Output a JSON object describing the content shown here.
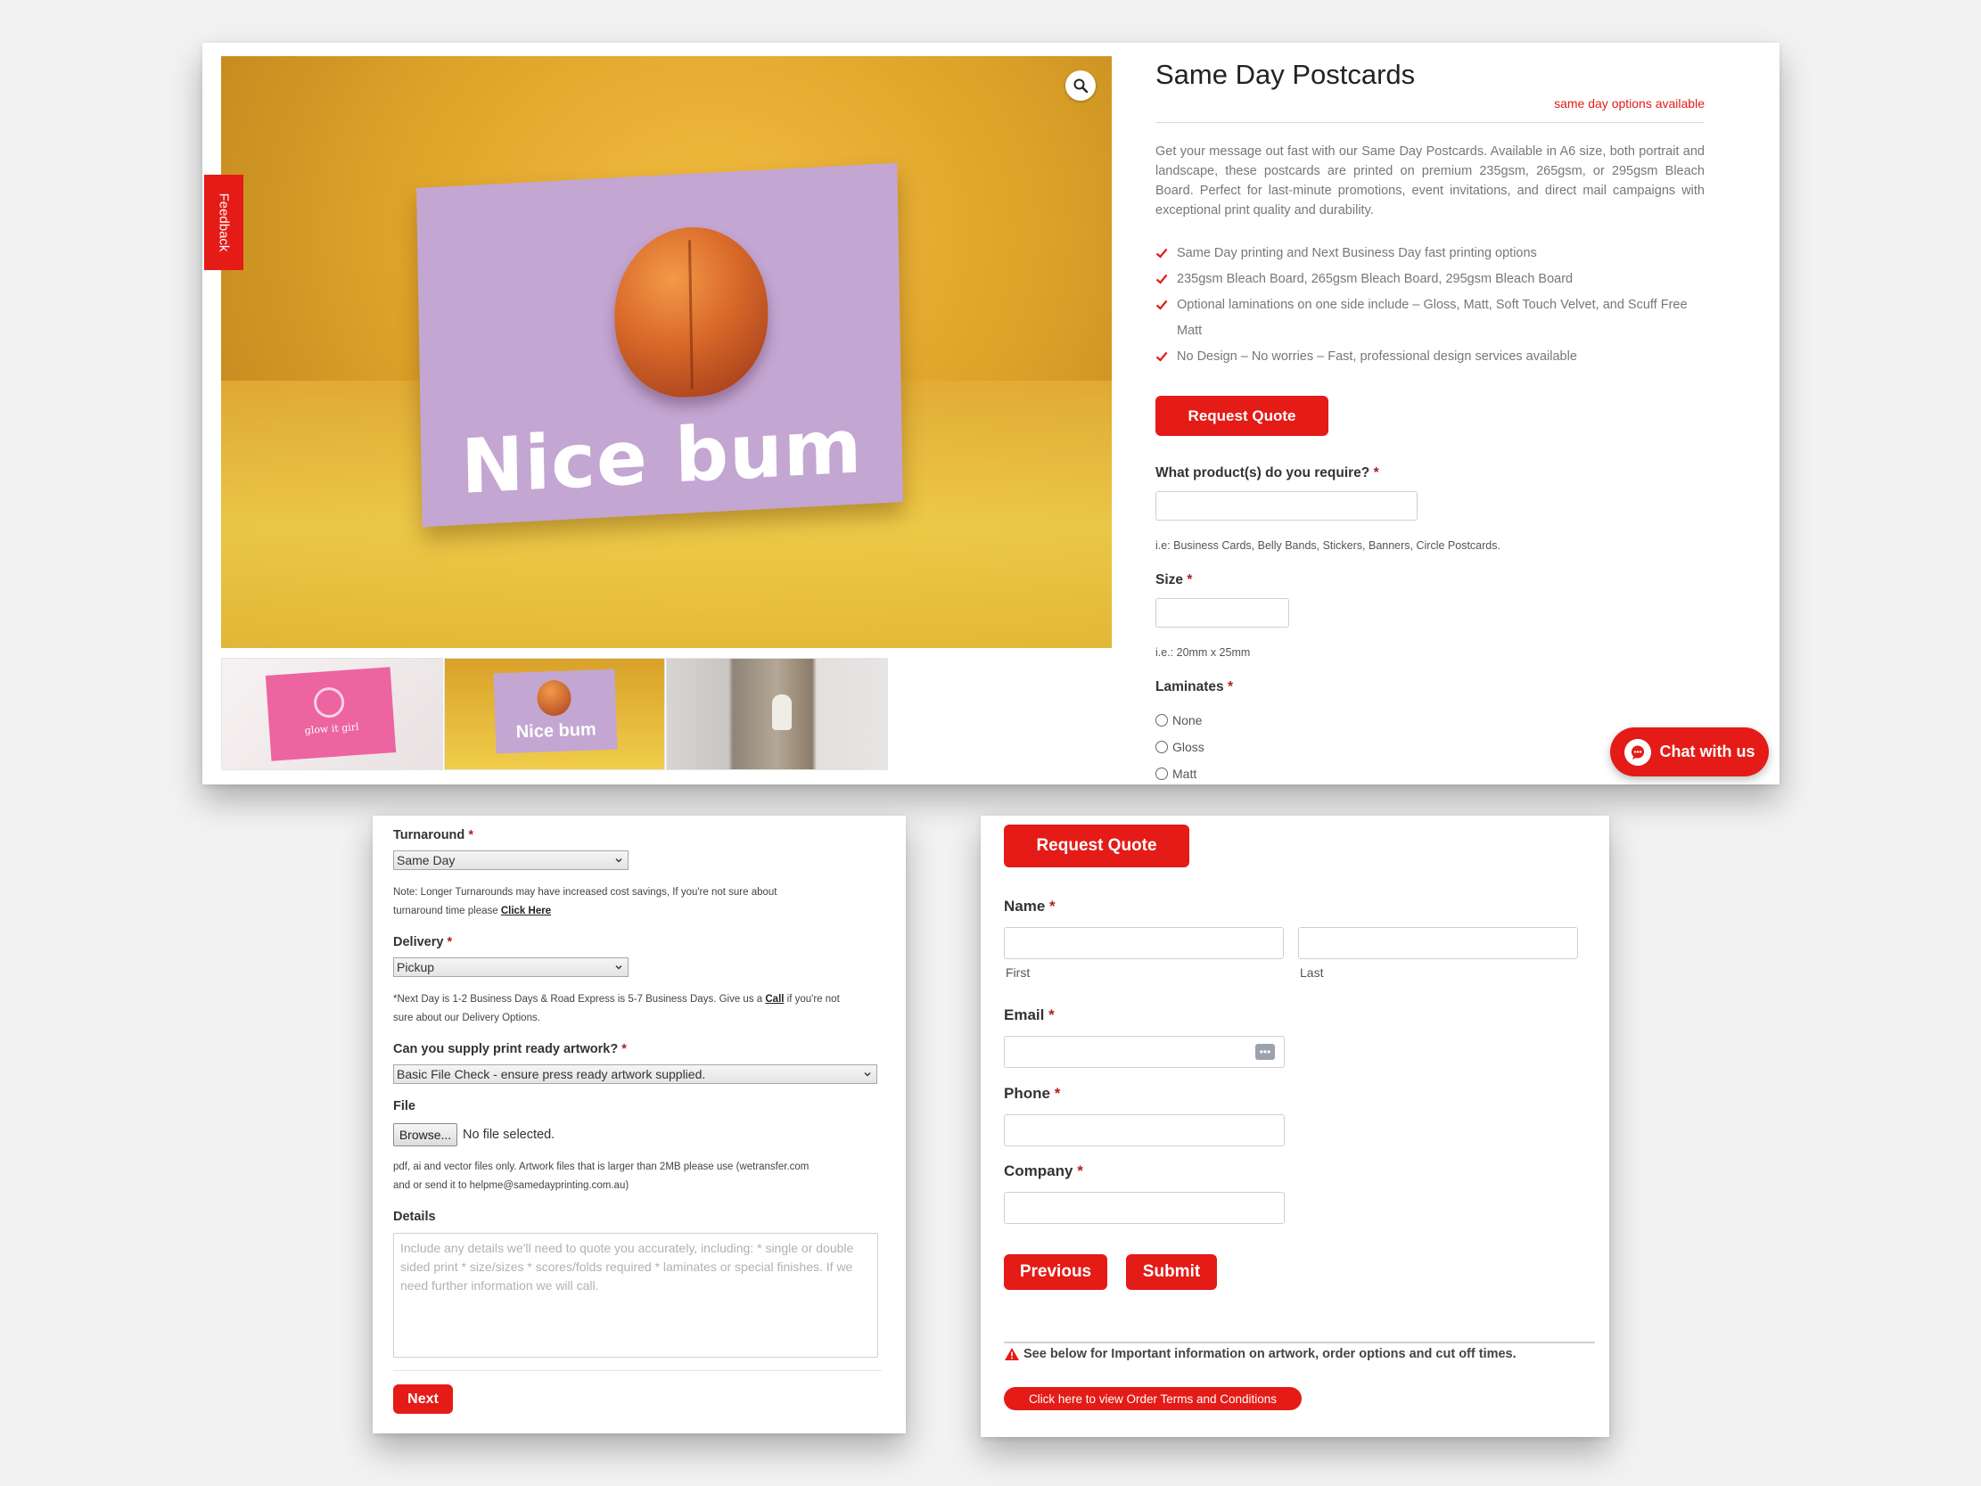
{
  "gallery": {
    "main_image_text": "Nice bum",
    "feedback_label": "Feedback",
    "thumbnails": [
      {
        "caption": "glow it girl"
      },
      {
        "caption": "Nice bum"
      },
      {
        "caption": ""
      }
    ]
  },
  "product": {
    "title": "Same Day Postcards",
    "same_day_note": "same day options available",
    "description": "Get your message out fast with our Same Day Postcards. Available in A6 size, both portrait and landscape, these postcards are printed on premium 235gsm, 265gsm, or 295gsm Bleach Board. Perfect for last-minute promotions, event invitations, and direct mail campaigns with exceptional print quality and durability.",
    "features": [
      "Same Day printing and Next Business Day fast printing options",
      "235gsm Bleach Board, 265gsm Bleach Board, 295gsm Bleach Board",
      "Optional laminations on one side include – Gloss, Matt, Soft Touch Velvet, and Scuff Free Matt",
      "No Design – No worries – Fast, professional design services available"
    ],
    "request_quote_label": "Request Quote"
  },
  "quote_form": {
    "products_label": "What product(s) do you require?",
    "products_hint": "i.e: Business Cards, Belly Bands, Stickers, Banners, Circle Postcards.",
    "size_label": "Size",
    "size_hint": "i.e.: 20mm x 25mm",
    "laminates_label": "Laminates",
    "laminates_options": [
      "None",
      "Gloss",
      "Matt"
    ],
    "required_mark": "*"
  },
  "chat": {
    "label": "Chat with us"
  },
  "step1": {
    "turnaround_label": "Turnaround",
    "turnaround_value": "Same Day",
    "turnaround_note_1": "Note: Longer Turnarounds may have increased cost savings, If you're not sure about",
    "turnaround_note_2": "turnaround time please",
    "turnaround_link": "Click Here",
    "delivery_label": "Delivery",
    "delivery_value": "Pickup",
    "delivery_note_1": "*Next Day is 1-2 Business Days & Road Express is 5-7 Business Days. Give us a",
    "delivery_link": "Call",
    "delivery_note_2": "if you're not",
    "delivery_note_3": "sure about our Delivery Options.",
    "artwork_label": "Can you supply print ready artwork?",
    "artwork_value": "Basic File Check - ensure press ready artwork supplied.",
    "file_label": "File",
    "browse_label": "Browse...",
    "no_file_text": "No file selected.",
    "file_note_1": "pdf, ai and vector files only. Artwork files that is larger than 2MB please use (wetransfer.com",
    "file_note_2": "and or send it to helpme@samedayprinting.com.au)",
    "details_label": "Details",
    "details_placeholder": "Include any details we'll need to quote you accurately, including: * single or double sided print * size/sizes * scores/folds required * laminates or special finishes. If we need further information we will call.",
    "next_label": "Next"
  },
  "step2": {
    "request_quote_label": "Request Quote",
    "name_label": "Name",
    "first_label": "First",
    "last_label": "Last",
    "email_label": "Email",
    "phone_label": "Phone",
    "company_label": "Company",
    "previous_label": "Previous",
    "submit_label": "Submit",
    "warning_text": "See below for Important information on artwork, order options and cut off times.",
    "terms_link": "Click here to view Order Terms and Conditions"
  },
  "colors": {
    "accent": "#e41b17",
    "required": "#b21e1e",
    "text": "#333333",
    "muted": "#777777"
  }
}
